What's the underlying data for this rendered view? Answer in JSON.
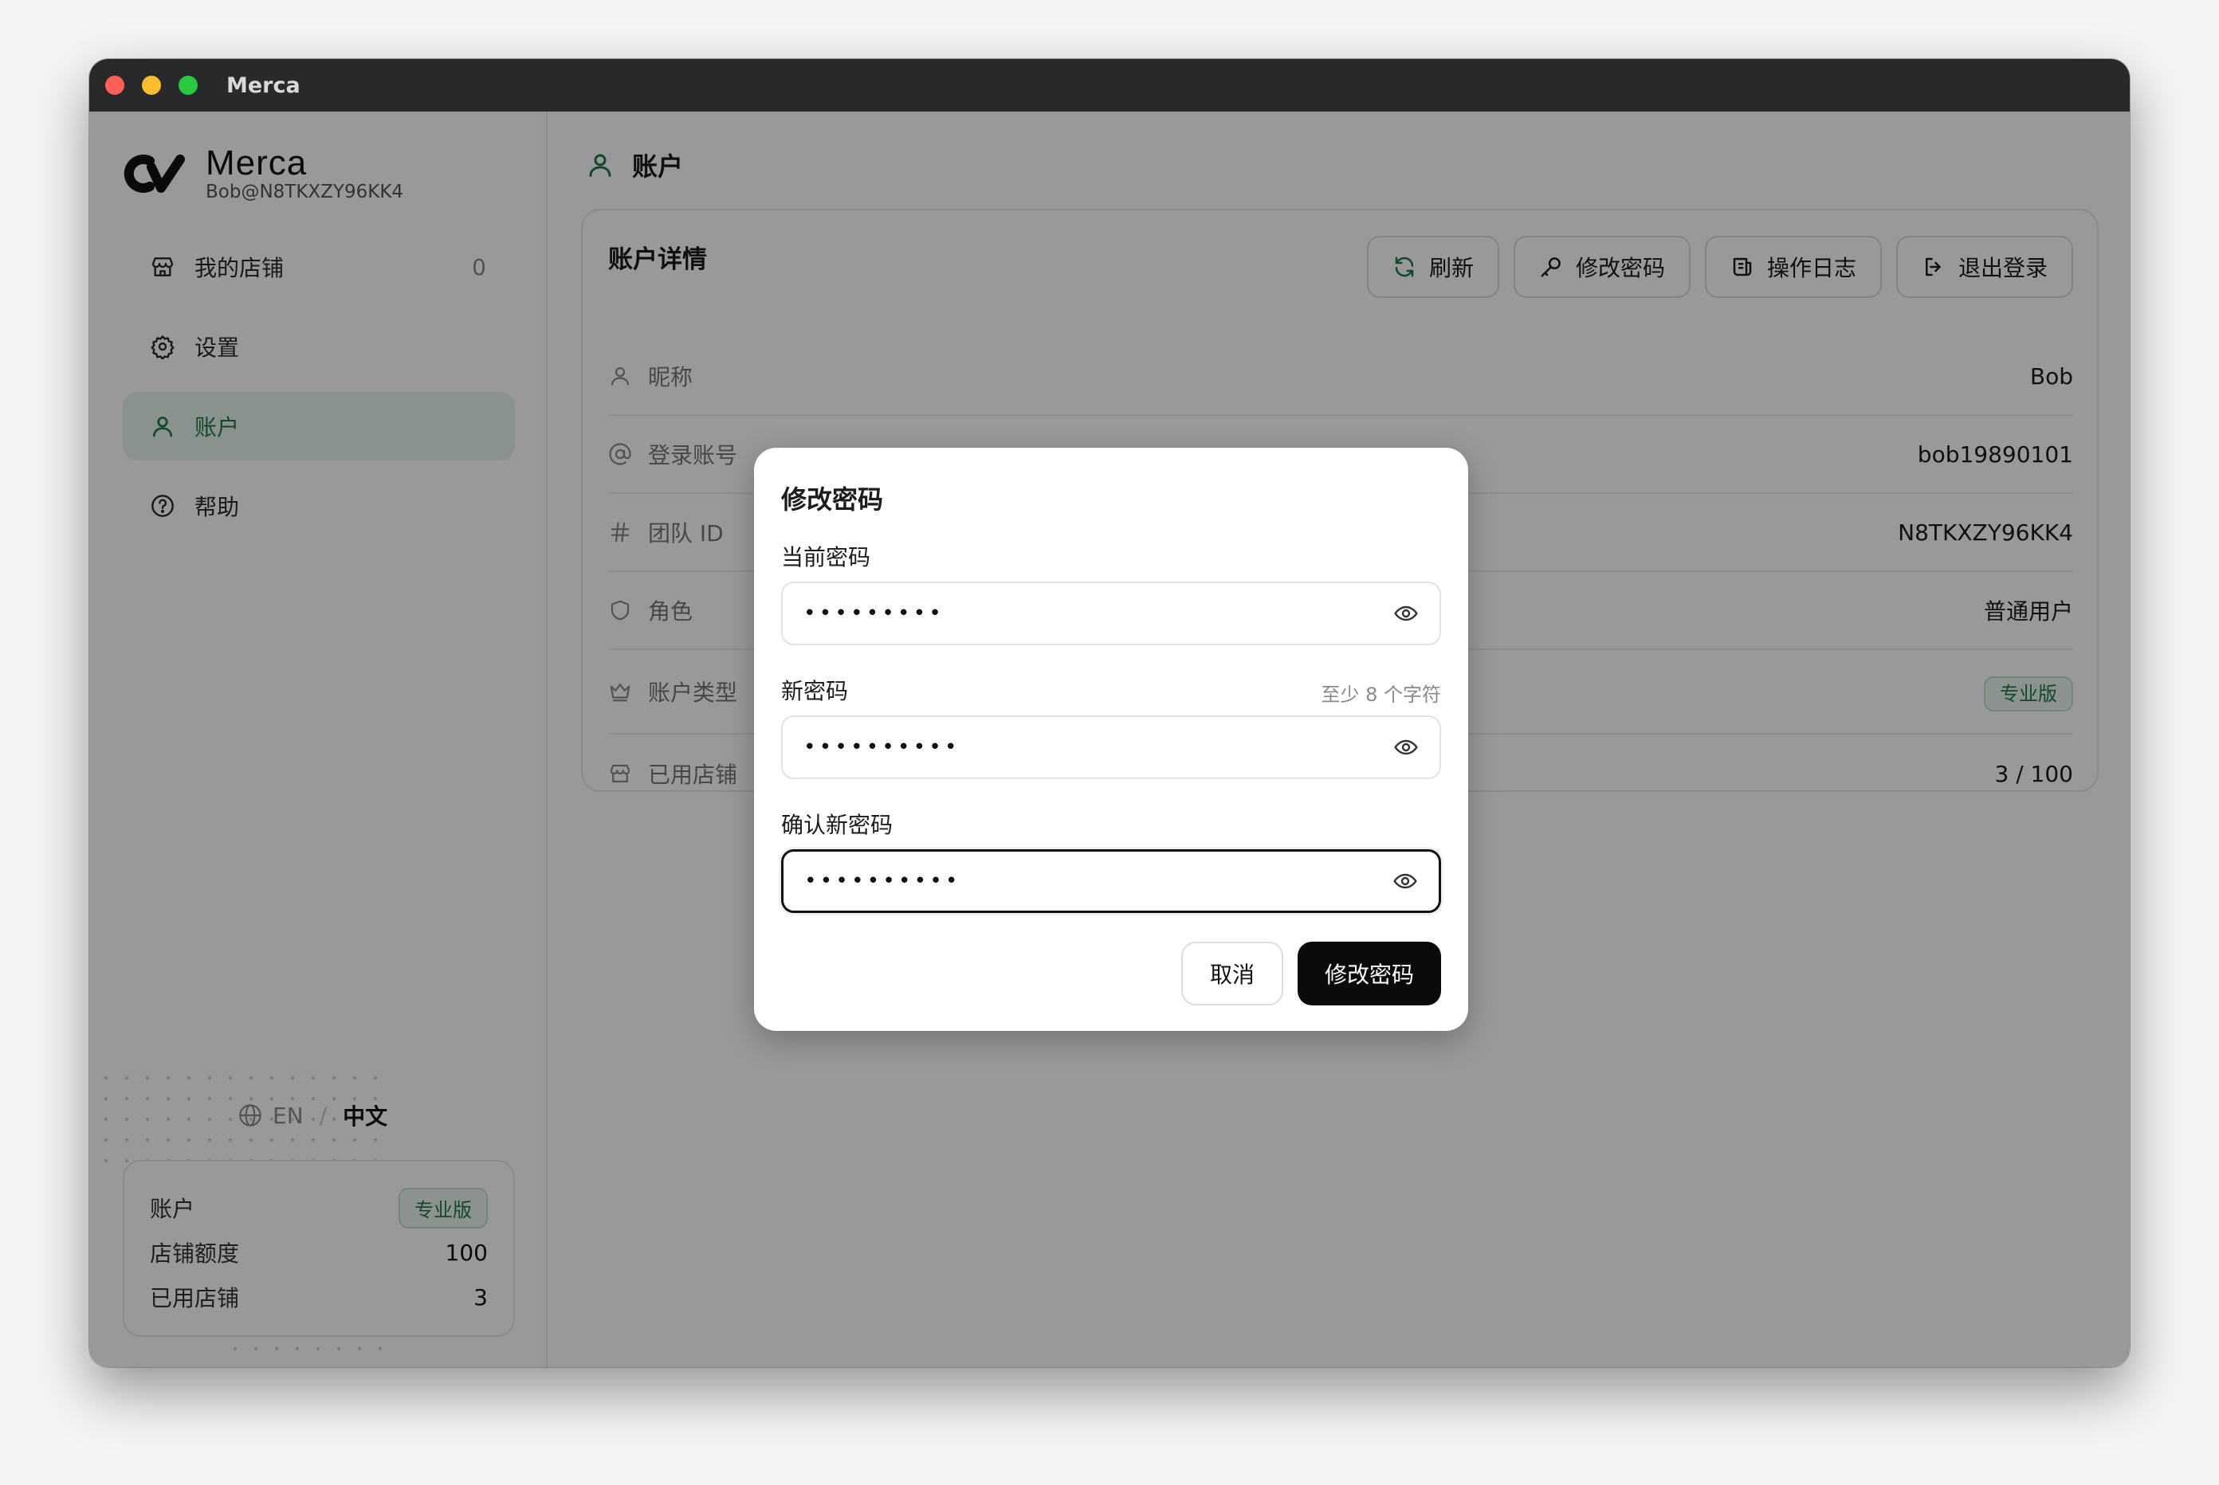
{
  "window": {
    "title": "Merca"
  },
  "brand": {
    "name": "Merca",
    "account": "Bob@N8TKXZY96KK4"
  },
  "sidebar": {
    "items": [
      {
        "label": "我的店铺",
        "icon": "store-icon",
        "count": "0"
      },
      {
        "label": "设置",
        "icon": "gear-icon"
      },
      {
        "label": "账户",
        "icon": "user-icon",
        "active": true
      },
      {
        "label": "帮助",
        "icon": "help-icon"
      }
    ],
    "language": {
      "en": "EN",
      "separator": "/",
      "zh": "中文"
    },
    "account_card": {
      "title": "账户",
      "badge": "专业版",
      "quota_label": "店铺额度",
      "quota_value": "100",
      "used_label": "已用店铺",
      "used_value": "3"
    }
  },
  "page": {
    "title": "账户"
  },
  "details": {
    "title": "账户详情",
    "actions": {
      "refresh": "刷新",
      "change_password": "修改密码",
      "logs": "操作日志",
      "logout": "退出登录"
    },
    "rows": [
      {
        "label": "昵称",
        "icon": "user-icon",
        "value": "Bob"
      },
      {
        "label": "登录账号",
        "icon": "at-icon",
        "value": "bob19890101"
      },
      {
        "label": "团队 ID",
        "icon": "hash-icon",
        "value": "N8TKXZY96KK4"
      },
      {
        "label": "角色",
        "icon": "shield-icon",
        "value": "普通用户"
      },
      {
        "label": "账户类型",
        "icon": "crown-icon",
        "value": "专业版"
      },
      {
        "label": "已用店铺",
        "icon": "store-icon",
        "value": "3 / 100"
      }
    ]
  },
  "dialog": {
    "title": "修改密码",
    "current_label": "当前密码",
    "current_value": "•••••••••",
    "new_label": "新密码",
    "new_hint": "至少 8 个字符",
    "new_value": "••••••••••",
    "confirm_label": "确认新密码",
    "confirm_value": "••••••••••",
    "cancel": "取消",
    "submit": "修改密码"
  },
  "colors": {
    "accent": "#1f7a4d",
    "accent_bg": "#e6f4ec",
    "primary_button": "#0b0b0b",
    "titlebar": "#27292b"
  }
}
